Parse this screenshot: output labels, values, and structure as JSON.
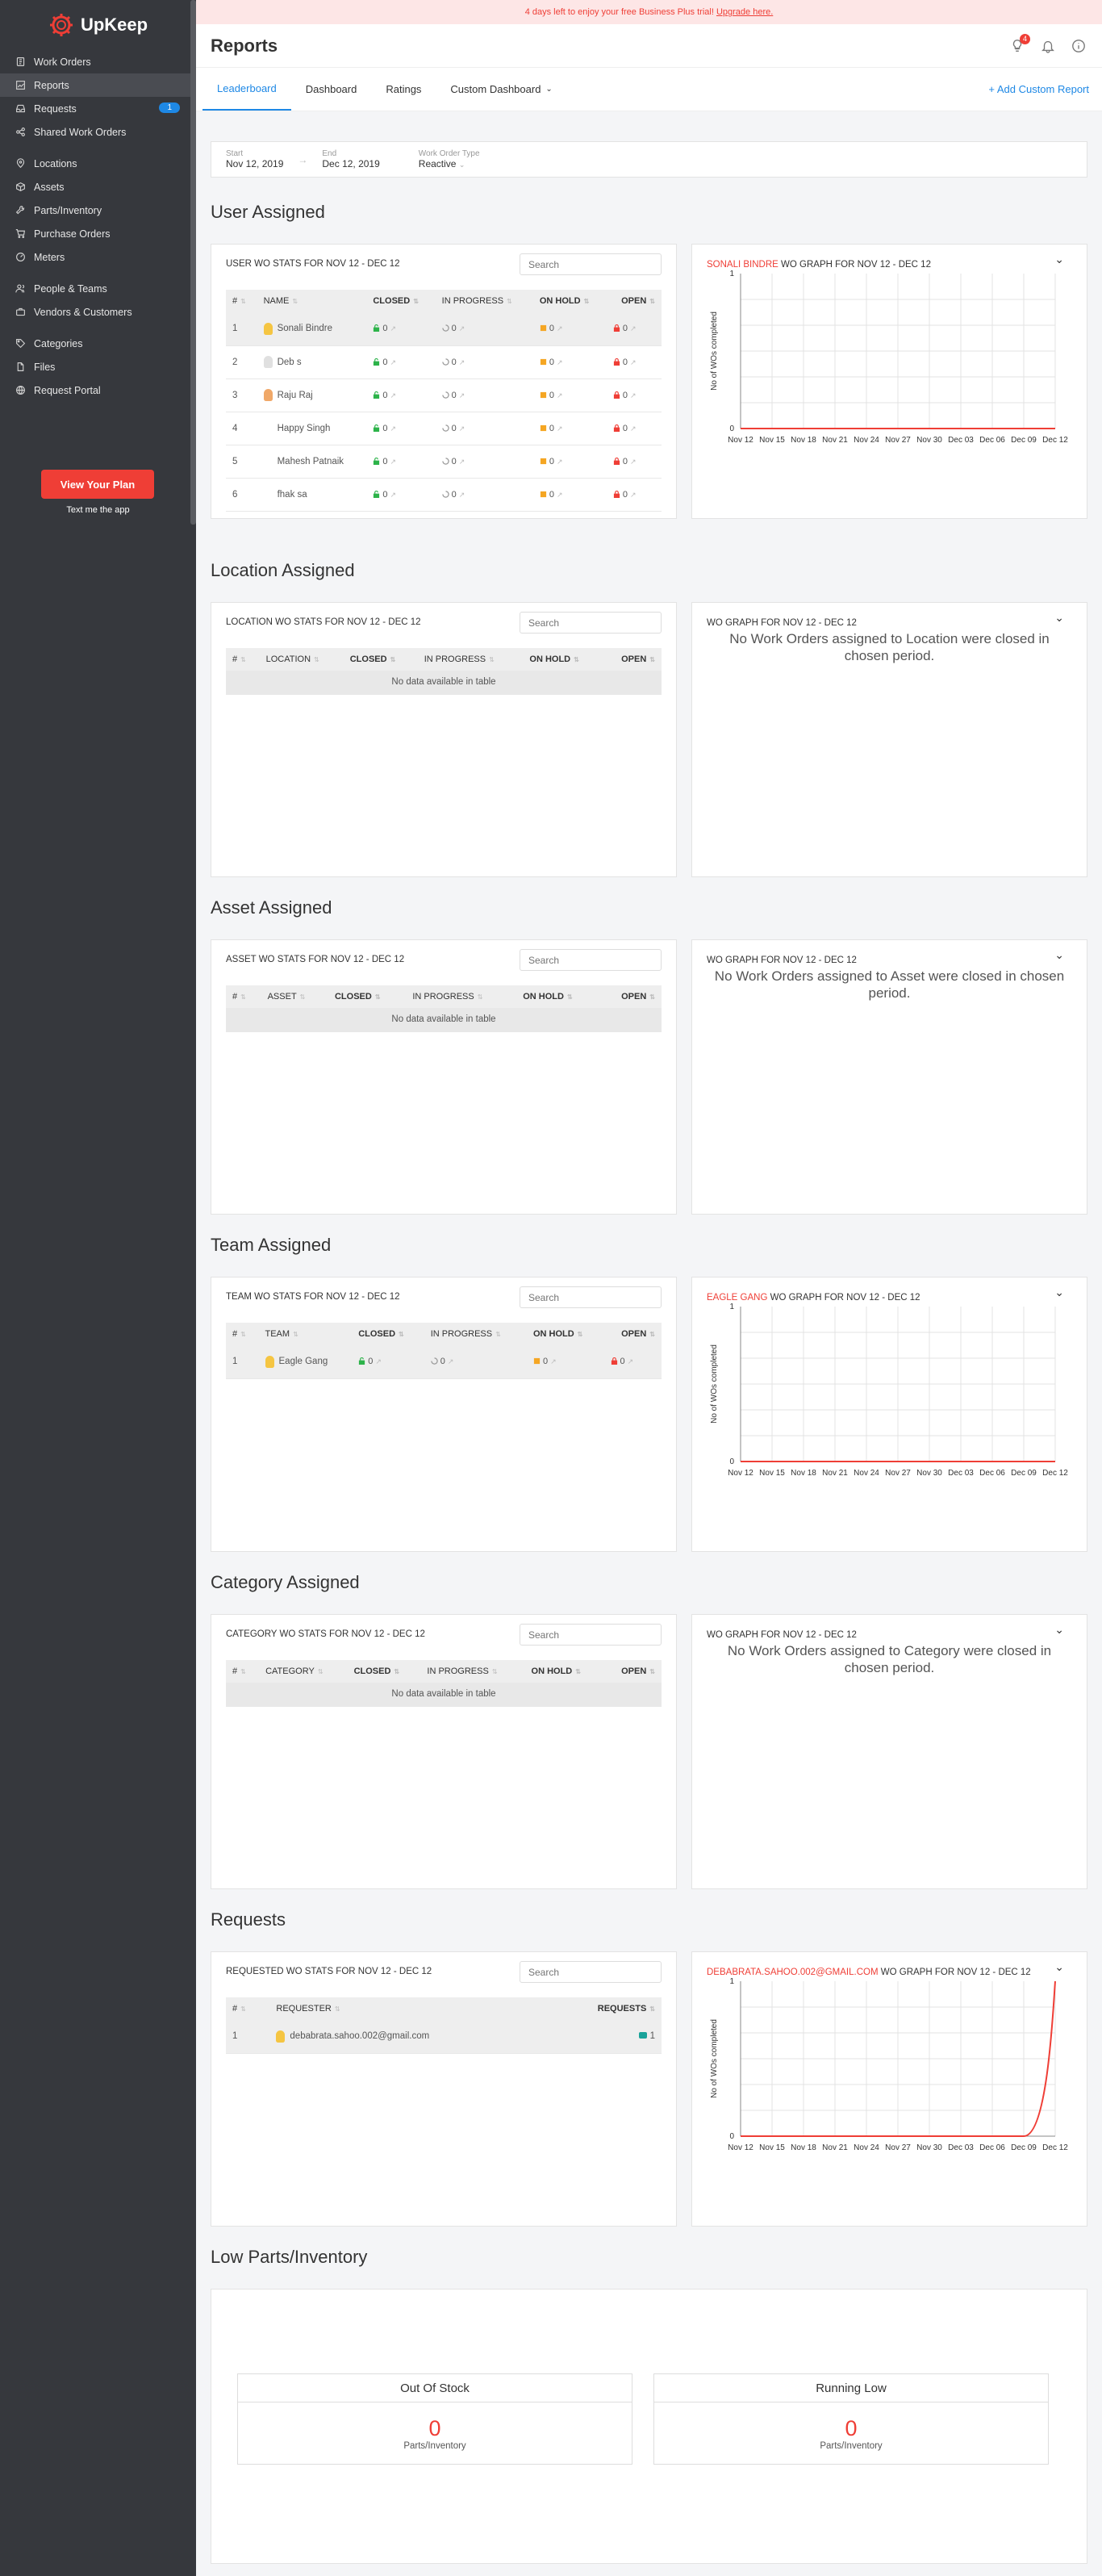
{
  "brand": {
    "name": "UpKeep",
    "accent": "#ef3e36",
    "link": "#1e88e5"
  },
  "sidebar": {
    "groups": [
      [
        {
          "label": "Work Orders",
          "icon": "clipboard-icon"
        },
        {
          "label": "Reports",
          "icon": "chart-icon",
          "active": true
        },
        {
          "label": "Requests",
          "icon": "inbox-icon",
          "badge": "1"
        },
        {
          "label": "Shared Work Orders",
          "icon": "share-icon"
        }
      ],
      [
        {
          "label": "Locations",
          "icon": "location-icon"
        },
        {
          "label": "Assets",
          "icon": "cube-icon"
        },
        {
          "label": "Parts/Inventory",
          "icon": "wrench-icon"
        },
        {
          "label": "Purchase Orders",
          "icon": "cart-icon"
        },
        {
          "label": "Meters",
          "icon": "gauge-icon"
        }
      ],
      [
        {
          "label": "People & Teams",
          "icon": "people-icon"
        },
        {
          "label": "Vendors & Customers",
          "icon": "briefcase-icon"
        }
      ],
      [
        {
          "label": "Categories",
          "icon": "tag-icon"
        },
        {
          "label": "Files",
          "icon": "file-icon"
        },
        {
          "label": "Request Portal",
          "icon": "portal-icon"
        }
      ]
    ],
    "plan_button": "View Your Plan",
    "text_app": "Text me the app"
  },
  "trial_banner": {
    "text": "4 days left to enjoy your free Business Plus trial! ",
    "link": "Upgrade here."
  },
  "header": {
    "title": "Reports",
    "notif_badge": "4"
  },
  "tabs": [
    {
      "label": "Leaderboard",
      "active": true
    },
    {
      "label": "Dashboard"
    },
    {
      "label": "Ratings"
    },
    {
      "label": "Custom Dashboard",
      "dropdown": true
    }
  ],
  "add_report": "+ Add Custom Report",
  "filters": {
    "start_label": "Start",
    "start_value": "Nov 12, 2019",
    "end_label": "End",
    "end_value": "Dec 12, 2019",
    "type_label": "Work Order Type",
    "type_value": "Reactive"
  },
  "search_placeholder": "Search",
  "no_data": "No data available in table",
  "sections": {
    "user": {
      "title": "User Assigned",
      "table_title": "USER WO STATS FOR NOV 12 - DEC 12",
      "columns": [
        "#",
        "NAME",
        "CLOSED",
        "IN PROGRESS",
        "ON HOLD",
        "OPEN"
      ],
      "rows": [
        {
          "n": "1",
          "name": "Sonali Bindre",
          "closed": "0",
          "prog": "0",
          "hold": "0",
          "open": "0",
          "bulb": "#f5c542"
        },
        {
          "n": "2",
          "name": "Deb s",
          "closed": "0",
          "prog": "0",
          "hold": "0",
          "open": "0",
          "bulb": "#e0e0e0"
        },
        {
          "n": "3",
          "name": "Raju Raj",
          "closed": "0",
          "prog": "0",
          "hold": "0",
          "open": "0",
          "bulb": "#f0a868"
        },
        {
          "n": "4",
          "name": "Happy Singh",
          "closed": "0",
          "prog": "0",
          "hold": "0",
          "open": "0",
          "bulb": ""
        },
        {
          "n": "5",
          "name": "Mahesh Patnaik",
          "closed": "0",
          "prog": "0",
          "hold": "0",
          "open": "0",
          "bulb": ""
        },
        {
          "n": "6",
          "name": "fhak sa",
          "closed": "0",
          "prog": "0",
          "hold": "0",
          "open": "0",
          "bulb": ""
        }
      ],
      "graph_title_hl": "SONALI BINDRE",
      "graph_title": " WO GRAPH FOR NOV 12 - DEC 12"
    },
    "location": {
      "title": "Location Assigned",
      "table_title": "LOCATION WO STATS FOR NOV 12 - DEC 12",
      "columns": [
        "#",
        "LOCATION",
        "CLOSED",
        "IN PROGRESS",
        "ON HOLD",
        "OPEN"
      ],
      "graph_title": "WO GRAPH FOR NOV 12 - DEC 12",
      "graph_empty": "No Work Orders assigned to Location were closed in chosen period."
    },
    "asset": {
      "title": "Asset Assigned",
      "table_title": "ASSET WO STATS FOR NOV 12 - DEC 12",
      "columns": [
        "#",
        "ASSET",
        "CLOSED",
        "IN PROGRESS",
        "ON HOLD",
        "OPEN"
      ],
      "graph_title": "WO GRAPH FOR NOV 12 - DEC 12",
      "graph_empty": "No Work Orders assigned to Asset were closed in chosen period."
    },
    "team": {
      "title": "Team Assigned",
      "table_title": "TEAM WO STATS FOR NOV 12 - DEC 12",
      "columns": [
        "#",
        "TEAM",
        "CLOSED",
        "IN PROGRESS",
        "ON HOLD",
        "OPEN"
      ],
      "rows": [
        {
          "n": "1",
          "name": "Eagle Gang",
          "closed": "0",
          "prog": "0",
          "hold": "0",
          "open": "0",
          "bulb": "#f5c542"
        }
      ],
      "graph_title_hl": "EAGLE GANG",
      "graph_title": " WO GRAPH FOR NOV 12 - DEC 12"
    },
    "category": {
      "title": "Category Assigned",
      "table_title": "CATEGORY WO STATS FOR NOV 12 - DEC 12",
      "columns": [
        "#",
        "CATEGORY",
        "CLOSED",
        "IN PROGRESS",
        "ON HOLD",
        "OPEN"
      ],
      "graph_title": "WO GRAPH FOR NOV 12 - DEC 12",
      "graph_empty": "No Work Orders assigned to Category were closed in chosen period."
    },
    "requests": {
      "title": "Requests",
      "table_title": "REQUESTED WO STATS FOR NOV 12 - DEC 12",
      "columns": [
        "#",
        "REQUESTER",
        "REQUESTS"
      ],
      "rows": [
        {
          "n": "1",
          "name": "debabrata.sahoo.002@gmail.com",
          "requests": "1",
          "bulb": "#f5c542"
        }
      ],
      "graph_title_hl": "DEBABRATA.SAHOO.002@GMAIL.COM",
      "graph_title": " WO GRAPH FOR NOV 12 - DEC 12"
    },
    "parts": {
      "title": "Low Parts/Inventory",
      "out_of_stock": {
        "label": "Out Of Stock",
        "value": "0",
        "unit": "Parts/Inventory"
      },
      "running_low": {
        "label": "Running Low",
        "value": "0",
        "unit": "Parts/Inventory"
      }
    }
  },
  "chart_data": [
    {
      "type": "line",
      "title": "SONALI BINDRE WO GRAPH FOR NOV 12 - DEC 12",
      "ylabel": "No of WOs completed",
      "xlabel": "",
      "x": [
        "Nov 12",
        "Nov 15",
        "Nov 18",
        "Nov 21",
        "Nov 24",
        "Nov 27",
        "Nov 30",
        "Dec 03",
        "Dec 06",
        "Dec 09",
        "Dec 12"
      ],
      "series": [
        {
          "values": [
            0,
            0,
            0,
            0,
            0,
            0,
            0,
            0,
            0,
            0,
            0
          ]
        }
      ],
      "ylim": [
        0,
        1
      ],
      "yticks": [
        "0",
        "1"
      ],
      "grid": true,
      "color": "#ef3e36"
    },
    {
      "type": "line",
      "title": "EAGLE GANG WO GRAPH FOR NOV 12 - DEC 12",
      "ylabel": "No of WOs completed",
      "xlabel": "",
      "x": [
        "Nov 12",
        "Nov 15",
        "Nov 18",
        "Nov 21",
        "Nov 24",
        "Nov 27",
        "Nov 30",
        "Dec 03",
        "Dec 06",
        "Dec 09",
        "Dec 12"
      ],
      "series": [
        {
          "values": [
            0,
            0,
            0,
            0,
            0,
            0,
            0,
            0,
            0,
            0,
            0
          ]
        }
      ],
      "ylim": [
        0,
        1
      ],
      "yticks": [
        "0",
        "1"
      ],
      "grid": true,
      "color": "#ef3e36"
    },
    {
      "type": "line",
      "title": "DEBABRATA.SAHOO.002@GMAIL.COM WO GRAPH FOR NOV 12 - DEC 12",
      "ylabel": "No of WOs completed",
      "xlabel": "",
      "x": [
        "Nov 12",
        "Nov 15",
        "Nov 18",
        "Nov 21",
        "Nov 24",
        "Nov 27",
        "Nov 30",
        "Dec 03",
        "Dec 06",
        "Dec 09",
        "Dec 12"
      ],
      "series": [
        {
          "values": [
            0,
            0,
            0,
            0,
            0,
            0,
            0,
            0,
            0,
            0,
            1
          ]
        }
      ],
      "ylim": [
        0,
        1
      ],
      "yticks": [
        "0",
        "1"
      ],
      "grid": true,
      "color": "#ef3e36"
    }
  ]
}
